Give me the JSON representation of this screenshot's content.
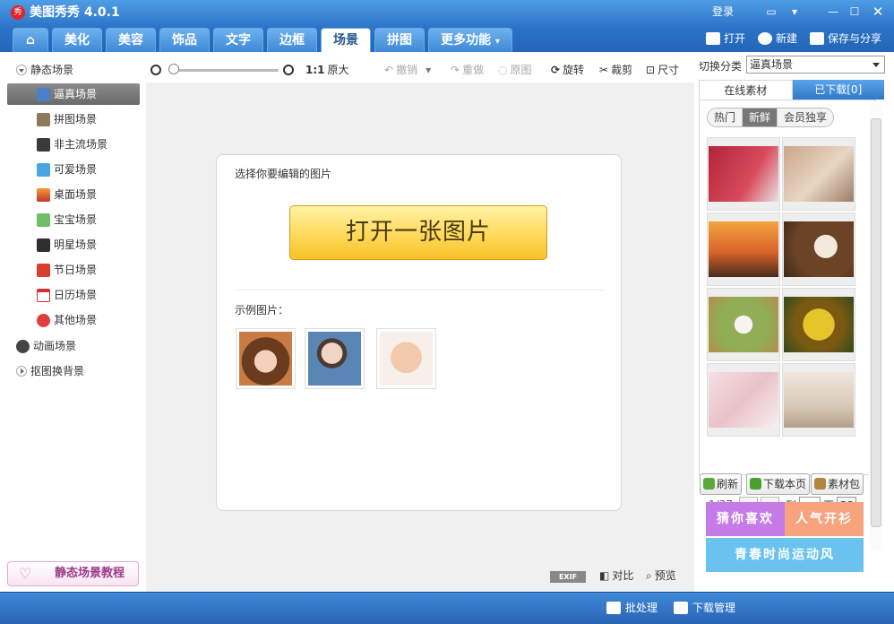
{
  "window": {
    "app_title": "美图秀秀 4.0.1",
    "login": "登录"
  },
  "tabs": [
    {
      "label": "美化"
    },
    {
      "label": "美容"
    },
    {
      "label": "饰品"
    },
    {
      "label": "文字"
    },
    {
      "label": "边框"
    },
    {
      "label": "场景",
      "active": true
    },
    {
      "label": "拼图"
    },
    {
      "label": "更多功能"
    }
  ],
  "header_actions": {
    "open": "打开",
    "new": "新建",
    "save_share": "保存与分享"
  },
  "sidebar": {
    "static_root": "静态场景",
    "items": [
      {
        "label": "逼真场景",
        "selected": true
      },
      {
        "label": "拼图场景"
      },
      {
        "label": "非主流场景"
      },
      {
        "label": "可爱场景"
      },
      {
        "label": "桌面场景"
      },
      {
        "label": "宝宝场景"
      },
      {
        "label": "明星场景"
      },
      {
        "label": "节日场景"
      },
      {
        "label": "日历场景"
      },
      {
        "label": "其他场景"
      }
    ],
    "animated_root": "动画场景",
    "matting_root": "抠图换背景",
    "tutorial_button": "静态场景教程"
  },
  "toolbar": {
    "actual_size": "原大",
    "actual_size_ratio": "1:1",
    "undo": "撤销",
    "redo": "重做",
    "original": "原图",
    "rotate": "旋转",
    "crop": "裁剪",
    "size": "尺寸"
  },
  "canvas": {
    "prompt": "选择你要编辑的图片",
    "open_button": "打开一张图片",
    "samples_label": "示例图片："
  },
  "bottom_tools": {
    "exif": "EXIF",
    "compare": "对比",
    "preview": "预览"
  },
  "right_panel": {
    "category_label": "切换分类",
    "category_value": "逼真场景",
    "tab_online": "在线素材",
    "tab_downloaded": "已下载[0]",
    "subtabs": [
      "热门",
      "新鲜",
      "会员独享"
    ],
    "selected_subtab": "新鲜",
    "pager": {
      "current": "1/37",
      "to": "到",
      "page": "页",
      "go": "GO"
    },
    "refresh": "刷新",
    "download_page": "下载本页",
    "material_pack": "素材包",
    "banners": {
      "guess": "猜你喜欢",
      "popular": "人气开衫",
      "youth": "青春时尚运动风"
    }
  },
  "statusbar": {
    "batch": "批处理",
    "download_manager": "下载管理"
  },
  "colors": {
    "brand_blue": "#2a72c6",
    "open_button_yellow": "#ffd95a",
    "selected_item": "#7a7a7a"
  }
}
